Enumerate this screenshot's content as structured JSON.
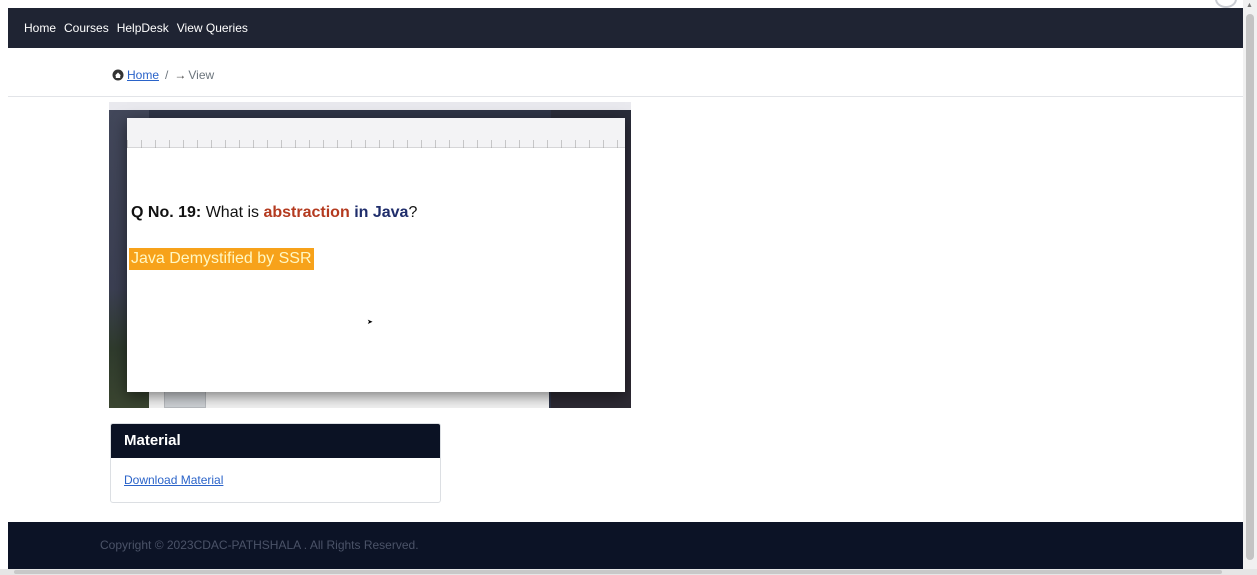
{
  "navbar": {
    "links": [
      "Home",
      "Courses",
      "HelpDesk",
      "View Queries"
    ]
  },
  "breadcrumb": {
    "home_label": "Home",
    "separator": "/",
    "current_label": "View",
    "home_icon": "home-icon",
    "arrow_icon": "arrow-right-icon"
  },
  "video": {
    "question_prefix": "Q No. 19:",
    "question_text": "What is",
    "question_keyword": "abstraction",
    "question_in": "in",
    "question_java": "Java",
    "question_suffix": "?",
    "banner": "Java Demystified by SSR",
    "question_color_keyword": "#b43a1f",
    "question_color_java": "#1f2d6b",
    "banner_color": "#f7a21a"
  },
  "material": {
    "title": "Material",
    "download_label": "Download Material"
  },
  "footer": {
    "copyright": "Copyright © 2023CDAC-PATHSHALA . All Rights Reserved."
  },
  "colors": {
    "navbar_bg": "#1f2433",
    "footer_bg": "#0c1326",
    "link": "#2a63c9"
  }
}
